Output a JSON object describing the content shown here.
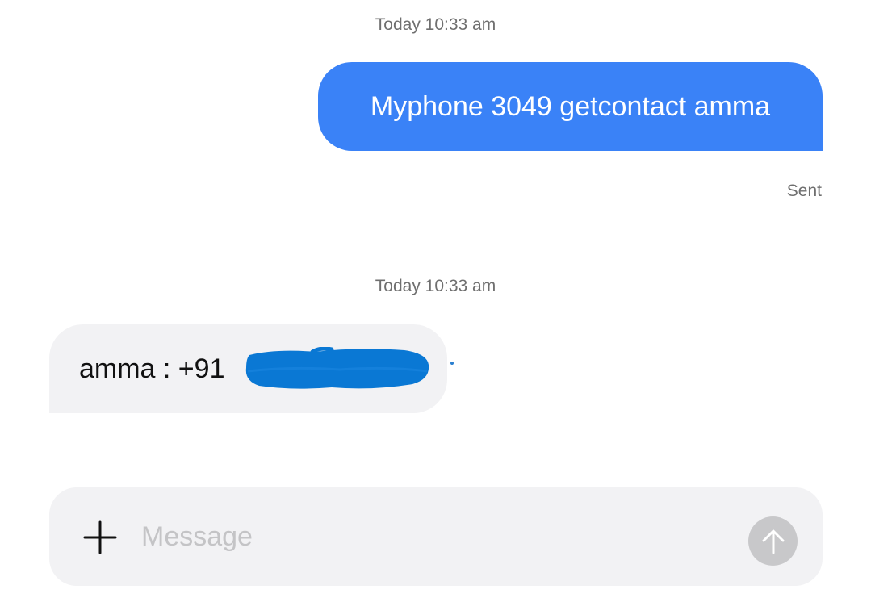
{
  "conversation": {
    "messages": [
      {
        "timestamp": "Today 10:33 am",
        "direction": "outgoing",
        "text": "Myphone 3049 getcontact amma",
        "status": "Sent"
      },
      {
        "timestamp": "Today 10:33 am",
        "direction": "incoming",
        "text": "amma : +91"
      }
    ]
  },
  "composer": {
    "placeholder": "Message",
    "value": "",
    "attach_icon": "plus-icon",
    "send_icon": "arrow-up-icon"
  },
  "colors": {
    "outgoing_bubble": "#3a82f7",
    "incoming_bubble": "#f2f2f4",
    "redaction": "#0a78d4",
    "send_button_disabled": "#c8c8ca"
  }
}
